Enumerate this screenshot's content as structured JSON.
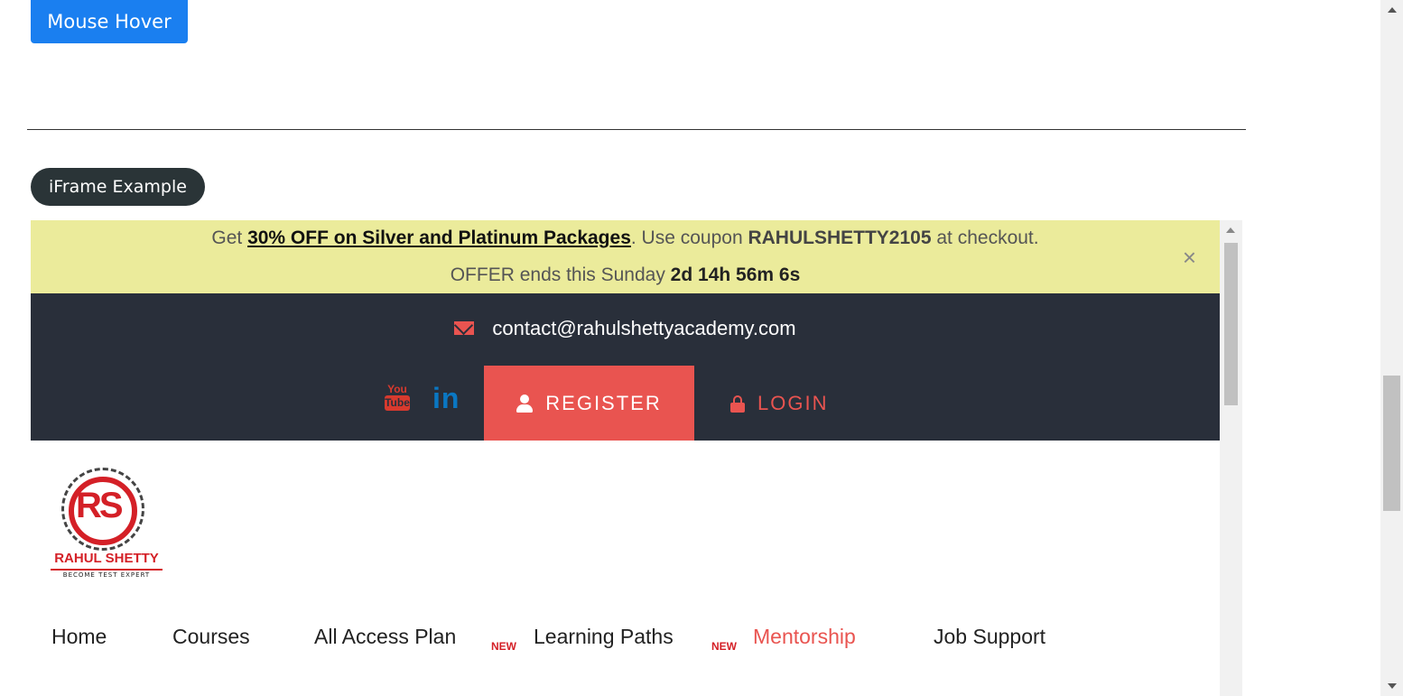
{
  "mouse_hover": {
    "label": "Mouse Hover"
  },
  "iframe_section": {
    "legend": "iFrame Example"
  },
  "promo": {
    "prefix": "Get ",
    "link_text": "30% OFF on Silver and Platinum Packages",
    "middle": ". Use coupon ",
    "coupon": "RAHULSHETTY2105",
    "suffix": " at checkout.",
    "offer_prefix": "OFFER ends this Sunday ",
    "countdown": "2d 14h 56m 6s",
    "close": "×"
  },
  "topbar": {
    "email": "contact@rahulshettyacademy.com",
    "youtube_top": "You",
    "youtube_bottom": "Tube",
    "linkedin": "in",
    "register": "REGISTER",
    "login": "LOGIN"
  },
  "logo": {
    "monogram": "RS",
    "name": "RAHUL SHETTY",
    "tagline": "BECOME TEST EXPERT"
  },
  "nav": {
    "items": [
      {
        "label": "Home"
      },
      {
        "label": "Courses"
      },
      {
        "label": "All Access Plan",
        "badge": "NEW"
      },
      {
        "label": "Learning Paths",
        "badge": "NEW"
      },
      {
        "label": "Mentorship"
      },
      {
        "label": "Job Support"
      }
    ]
  },
  "colors": {
    "primary_button": "#1a7ff0",
    "accent": "#e95450",
    "topbar": "#292f3a",
    "banner": "#ebeb9b"
  }
}
